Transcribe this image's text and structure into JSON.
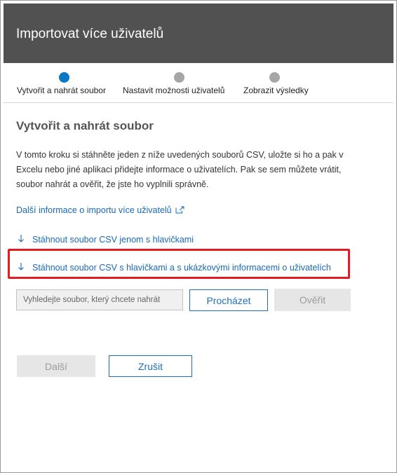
{
  "header": {
    "title": "Importovat více uživatelů"
  },
  "steps": [
    {
      "label": "Vytvořit a nahrát soubor",
      "state": "active"
    },
    {
      "label": "Nastavit možnosti uživatelů",
      "state": "inactive"
    },
    {
      "label": "Zobrazit výsledky",
      "state": "inactive"
    }
  ],
  "content": {
    "title": "Vytvořit a nahrát soubor",
    "description": "V tomto kroku si stáhněte jeden z níže uvedených souborů CSV, uložte si ho a pak v Excelu nebo jiné aplikaci přidejte informace o uživatelích. Pak se sem můžete vrátit, soubor nahrát a ověřit, že jste ho vyplnili správně.",
    "learn_more_link": "Další informace o importu více uživatelů",
    "download_headers_link": "Stáhnout soubor CSV jenom s hlavičkami",
    "download_sample_link": "Stáhnout soubor CSV s hlavičkami a s ukázkovými informacemi o uživatelích"
  },
  "upload": {
    "placeholder": "Vyhledejte soubor, který chcete nahrát",
    "value": "",
    "browse_label": "Procházet",
    "verify_label": "Ověřit"
  },
  "footer": {
    "next_label": "Další",
    "cancel_label": "Zrušit"
  },
  "colors": {
    "accent": "#0a78c5",
    "header_bg": "#515151",
    "highlight": "#e51c23",
    "link": "#1769b8"
  }
}
